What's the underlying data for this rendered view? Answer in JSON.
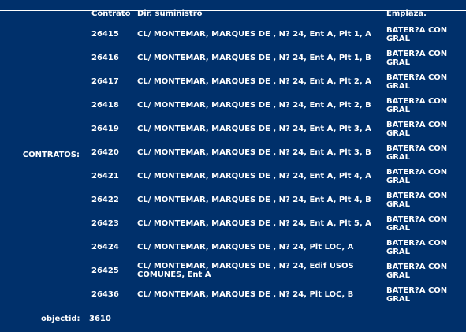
{
  "contratos_label": "CONTRATOS:",
  "headers": {
    "contrato": "Contrato",
    "dir": "Dir. suministro",
    "emplaza": "Emplaza."
  },
  "rows": [
    {
      "contrato": "26415",
      "dir": "CL/ MONTEMAR, MARQUES DE , N? 24, Ent A, Plt 1, A",
      "emplaza": "BATER?A CON GRAL"
    },
    {
      "contrato": "26416",
      "dir": "CL/ MONTEMAR, MARQUES DE , N? 24, Ent A, Plt 1, B",
      "emplaza": "BATER?A CON GRAL"
    },
    {
      "contrato": "26417",
      "dir": "CL/ MONTEMAR, MARQUES DE , N? 24, Ent A, Plt 2, A",
      "emplaza": "BATER?A CON GRAL"
    },
    {
      "contrato": "26418",
      "dir": "CL/ MONTEMAR, MARQUES DE , N? 24, Ent A, Plt 2, B",
      "emplaza": "BATER?A CON GRAL"
    },
    {
      "contrato": "26419",
      "dir": "CL/ MONTEMAR, MARQUES DE , N? 24, Ent A, Plt 3, A",
      "emplaza": "BATER?A CON GRAL"
    },
    {
      "contrato": "26420",
      "dir": "CL/ MONTEMAR, MARQUES DE , N? 24, Ent A, Plt 3, B",
      "emplaza": "BATER?A CON GRAL"
    },
    {
      "contrato": "26421",
      "dir": "CL/ MONTEMAR, MARQUES DE , N? 24, Ent A, Plt 4, A",
      "emplaza": "BATER?A CON GRAL"
    },
    {
      "contrato": "26422",
      "dir": "CL/ MONTEMAR, MARQUES DE , N? 24, Ent A, Plt 4, B",
      "emplaza": "BATER?A CON GRAL"
    },
    {
      "contrato": "26423",
      "dir": "CL/ MONTEMAR, MARQUES DE , N? 24, Ent A, Plt 5, A",
      "emplaza": "BATER?A CON GRAL"
    },
    {
      "contrato": "26424",
      "dir": "CL/ MONTEMAR, MARQUES DE , N? 24, Plt LOC, A",
      "emplaza": "BATER?A CON GRAL"
    },
    {
      "contrato": "26425",
      "dir": "CL/ MONTEMAR, MARQUES DE , N? 24, Edif USOS COMUNES, Ent A",
      "emplaza": "BATER?A CON GRAL"
    },
    {
      "contrato": "26436",
      "dir": "CL/ MONTEMAR, MARQUES DE , N? 24, Plt LOC, B",
      "emplaza": "BATER?A CON GRAL"
    }
  ],
  "objectid": {
    "label": "objectid:",
    "value": "3610"
  },
  "colors": {
    "background": "#00306b",
    "text": "#ffffff"
  }
}
